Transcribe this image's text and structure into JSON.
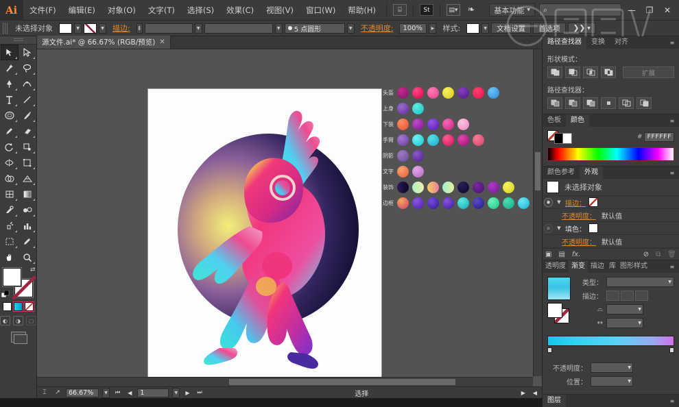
{
  "app": {
    "logo": "Ai",
    "title": "Adobe Illustrator"
  },
  "menubar": {
    "items": [
      {
        "label": "文件(F)"
      },
      {
        "label": "编辑(E)"
      },
      {
        "label": "对象(O)"
      },
      {
        "label": "文字(T)"
      },
      {
        "label": "选择(S)"
      },
      {
        "label": "效果(C)"
      },
      {
        "label": "视图(V)"
      },
      {
        "label": "窗口(W)"
      },
      {
        "label": "帮助(H)"
      }
    ],
    "bridge_icon": "bridge-icon",
    "stock_icon": "st-icon",
    "arrange_icon": "arrange-documents-icon",
    "cc_icon": "cc-libraries-icon",
    "workspace": "基本功能",
    "search_placeholder": "",
    "window_buttons": {
      "minimize": "—",
      "maximize": "❐",
      "close": "✕"
    }
  },
  "controlbar": {
    "selection_label": "未选择对象",
    "fill_swatch": "#FFFFFF",
    "stroke_label": "描边:",
    "stroke_weight": "",
    "stroke_profile": "",
    "brush_def": "5 点圆形",
    "opacity_label": "不透明度:",
    "opacity_value": "100%",
    "style_label": "样式:",
    "doc_setup": "文档设置",
    "preferences": "首选项",
    "more_label": "❯❯"
  },
  "toolbox": {
    "tools": [
      "selection-tool",
      "direct-selection-tool",
      "magic-wand-tool",
      "lasso-tool",
      "pen-tool",
      "curvature-tool",
      "type-tool",
      "line-segment-tool",
      "ellipse-tool",
      "paintbrush-tool",
      "pencil-tool",
      "eraser-tool",
      "rotate-tool",
      "scale-tool",
      "width-tool",
      "free-transform-tool",
      "shape-builder-tool",
      "perspective-grid-tool",
      "mesh-tool",
      "gradient-tool",
      "eyedropper-tool",
      "blend-tool",
      "symbol-sprayer-tool",
      "column-graph-tool",
      "artboard-tool",
      "slice-tool",
      "hand-tool",
      "zoom-tool"
    ],
    "fill_color": "#FFFFFF",
    "stroke_color": "#FFFFFF",
    "color_modes": [
      "color-mode-icon",
      "gradient-mode-icon",
      "none-mode-icon"
    ],
    "screen_modes": [
      "normal-screen-mode",
      "full-screen-menu-mode",
      "full-screen-mode"
    ],
    "change_screen_mode": "change-screen-mode-icon"
  },
  "document": {
    "tab_title": "源文件.ai* @ 66.67% (RGB/预览)",
    "close_glyph": "✕"
  },
  "palette": {
    "rows": [
      {
        "label": "头盔",
        "colors": [
          "#9b1f6e",
          "#e8246a",
          "#e8559b",
          "#e8e040",
          "#6b2a9e",
          "#f0325f",
          "#4ba8ee"
        ]
      },
      {
        "label": "上身",
        "colors": [
          "#7d4fb5",
          "#35d8d0"
        ]
      },
      {
        "label": "下装",
        "colors": [
          "#e8674f",
          "#a02ba8",
          "#7b2fcf",
          "#e0479f",
          "#efa3cd"
        ]
      },
      {
        "label": "手臂",
        "colors": [
          "#8f5ac0",
          "#2ed6e0",
          "#29c9d8",
          "#ea2f6e",
          "#c9318d",
          "#e25c7f"
        ]
      },
      {
        "label": "阴影",
        "colors": [
          "#7e5aaa",
          "#6a3fa0"
        ]
      },
      {
        "label": "文字",
        "colors": [
          "#e8834f",
          "#d38ad8"
        ]
      },
      {
        "label": "装饰",
        "colors": [
          "#1a1438",
          "#7fe0a8",
          "#e8c060",
          "#7de8e0",
          "#191034",
          "#5d1b7f",
          "#8a2aa8",
          "#e8e840"
        ]
      },
      {
        "label": "边框",
        "colors": [
          "#c83f6e",
          "#5a35b5",
          "#3b2c9e",
          "#4a2f9e",
          "#2cd0c8",
          "#2f2a8f",
          "#3dd8a0",
          "#22c8a0",
          "#3ad8e0",
          "#7a4fd8",
          "#e8487f",
          "#6d1f6e"
        ]
      }
    ]
  },
  "canvas": {
    "zoom": "66.67%"
  },
  "statusbar": {
    "zoom": "66.67%",
    "artboard_number": "1",
    "status_text": "选择",
    "prev_icon": "prev-artboard-icon",
    "next_icon": "next-artboard-icon"
  },
  "pathfinder_panel": {
    "tabs": [
      {
        "label": "路径查找器",
        "active": true
      },
      {
        "label": "变换",
        "active": false
      },
      {
        "label": "对齐",
        "active": false
      }
    ],
    "shape_modes_label": "形状模式：",
    "shape_modes": [
      "unite-icon",
      "minus-front-icon",
      "intersect-icon",
      "exclude-icon"
    ],
    "expand_label": "扩展",
    "pathfinders_label": "路径查找器：",
    "pathfinders": [
      "divide-icon",
      "trim-icon",
      "merge-icon",
      "crop-icon",
      "outline-icon",
      "minus-back-icon"
    ]
  },
  "color_panel": {
    "tabs": [
      {
        "label": "色板",
        "active": false
      },
      {
        "label": "颜色",
        "active": true
      }
    ],
    "hex_label": "#",
    "hex_value": "FFFFFF"
  },
  "appearance_panel": {
    "tabs": [
      {
        "label": "颜色参考",
        "active": false
      },
      {
        "label": "外观",
        "active": true
      }
    ],
    "target": "未选择对象",
    "rows": [
      {
        "name": "描边：",
        "type": "stroke",
        "indent": false,
        "visible": true
      },
      {
        "name": "不透明度：",
        "value": "默认值",
        "indent": true,
        "visible": false
      },
      {
        "name": "填色：",
        "type": "fill",
        "indent": false,
        "visible": true
      },
      {
        "name": "不透明度：",
        "value": "默认值",
        "indent": true,
        "visible": false
      }
    ],
    "footer_icons": [
      "add-new-stroke-icon",
      "add-new-fill-icon",
      "add-new-effect-icon",
      "clear-appearance-icon",
      "duplicate-item-icon",
      "delete-item-icon"
    ]
  },
  "gradient_panel": {
    "tabs": [
      {
        "label": "透明度",
        "active": false
      },
      {
        "label": "渐变",
        "active": true
      },
      {
        "label": "描边",
        "active": false
      },
      {
        "label": "库",
        "active": false
      },
      {
        "label": "图形样式",
        "active": false
      }
    ],
    "type_label": "类型：",
    "type_value": "",
    "stroke_label": "描边：",
    "angle_label": "",
    "angle_value": "",
    "aspect_label": "",
    "aspect_value": "",
    "opacity_label": "不透明度：",
    "opacity_value": "",
    "location_label": "位置：",
    "location_value": ""
  },
  "layers_panel": {
    "tab": "图层"
  }
}
